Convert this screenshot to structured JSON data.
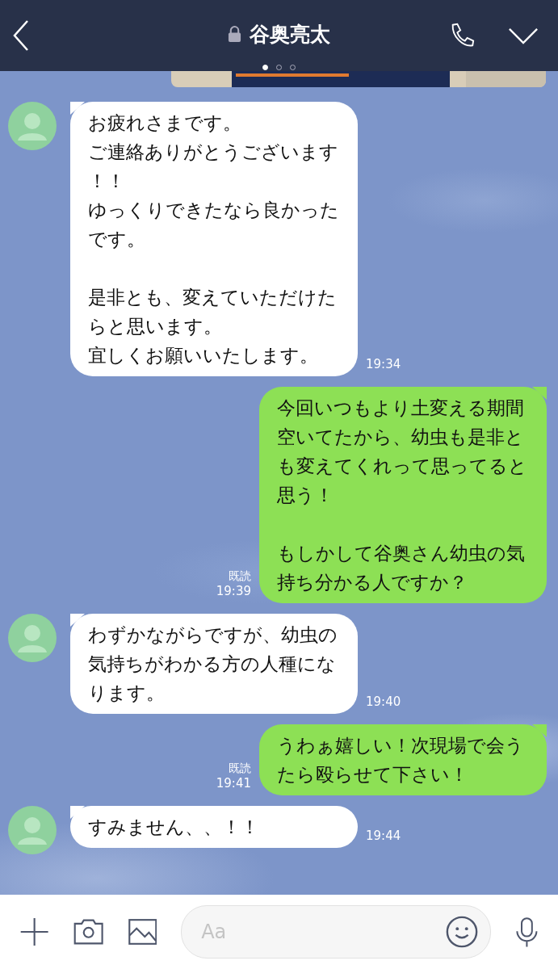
{
  "header": {
    "title": "谷奥亮太",
    "locked": true,
    "pages": [
      {
        "selected": true
      },
      {
        "selected": false
      },
      {
        "selected": false
      }
    ]
  },
  "messages": [
    {
      "kind": "incoming",
      "paragraphs": [
        [
          "お疲れさまです。",
          "ご連絡ありがとうございます！！",
          "ゆっくりできたなら良かったです。"
        ],
        [
          "是非とも、変えていただけたらと思います。",
          "宜しくお願いいたします。"
        ]
      ],
      "time": "19:34"
    },
    {
      "kind": "outgoing",
      "paragraphs": [
        [
          "今回いつもより土変える期間空いてたから、幼虫も是非とも変えてくれって思ってると思う！"
        ],
        [
          "もしかして谷奥さん幼虫の気持ち分かる人ですか？"
        ]
      ],
      "read": "既読",
      "time": "19:39"
    },
    {
      "kind": "incoming",
      "paragraphs": [
        [
          "わずかながらですが、幼虫の気持ちがわかる方の人種になります。"
        ]
      ],
      "time": "19:40"
    },
    {
      "kind": "outgoing",
      "paragraphs": [
        [
          "うわぁ嬉しい！次現場で会うたら殴らせて下さい！"
        ]
      ],
      "read": "既読",
      "time": "19:41"
    },
    {
      "kind": "incoming",
      "paragraphs": [
        [
          "すみません、、！！"
        ]
      ],
      "time": "19:44"
    }
  ],
  "input": {
    "placeholder": "Aa"
  }
}
